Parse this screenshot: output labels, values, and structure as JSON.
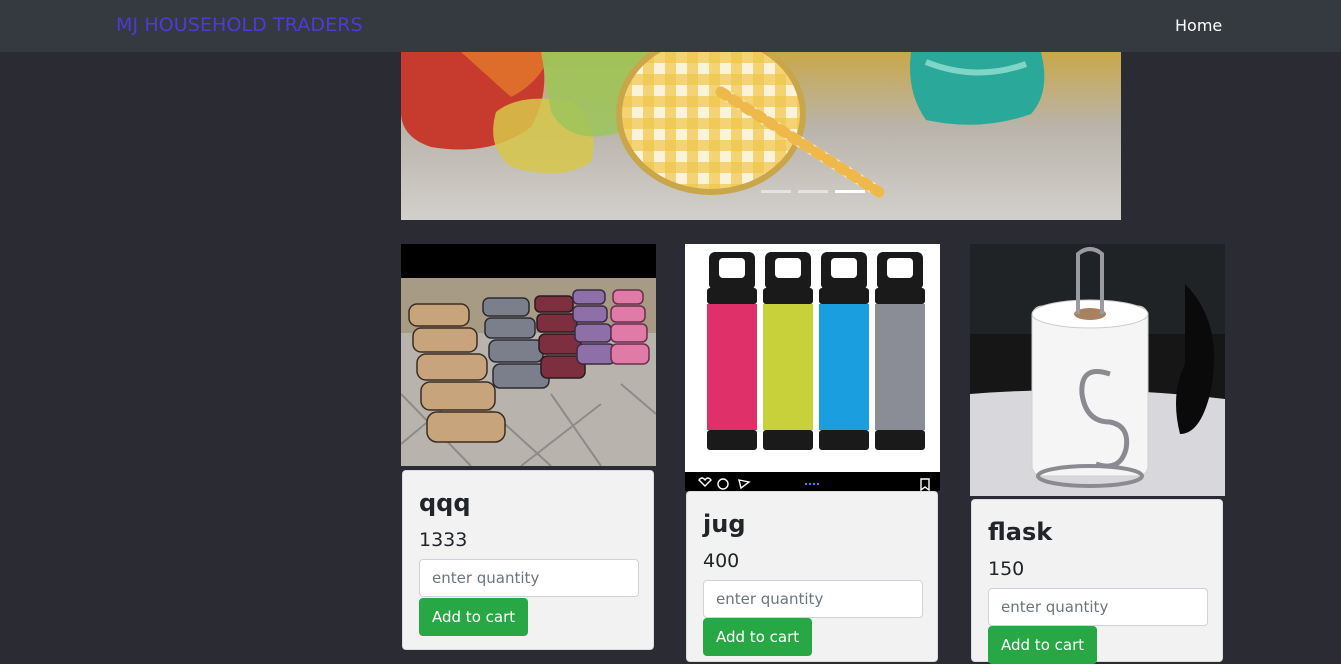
{
  "navbar": {
    "brand": "MJ HOUSEHOLD TRADERS",
    "home": "Home",
    "brand_color": "#4a3cd4",
    "background": "#343a40"
  },
  "products": [
    {
      "title": "qqq",
      "price": "1333",
      "placeholder": "enter quantity",
      "button": "Add to cart"
    },
    {
      "title": "jug",
      "price": "400",
      "placeholder": "enter quantity",
      "button": "Add to cart"
    },
    {
      "title": "flask",
      "price": "150",
      "placeholder": "enter quantity",
      "button": "Add to cart"
    }
  ],
  "colors": {
    "page_background": "#2b2b33",
    "card_background": "#f2f2f2",
    "button_green": "#28a745"
  }
}
